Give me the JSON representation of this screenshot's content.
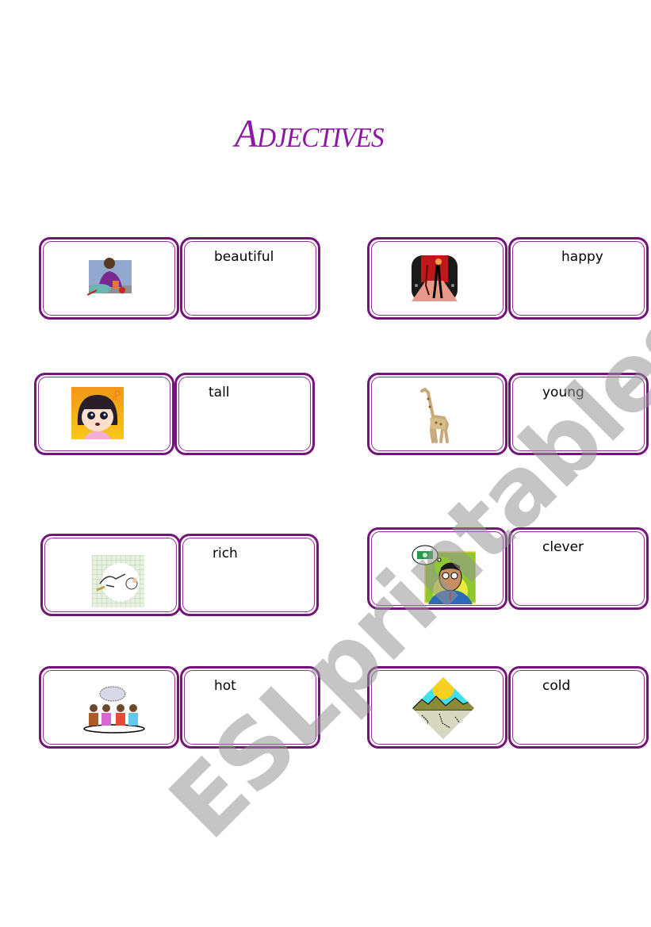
{
  "document": {
    "title": "Adjectives",
    "watermark": "ESLprintables.com"
  },
  "dominoes": [
    {
      "word": "beautiful",
      "picture": "man-eating-meal-icon"
    },
    {
      "word": "happy",
      "picture": "woman-on-runway-icon"
    },
    {
      "word": "tall",
      "picture": "cartoon-girl-icon"
    },
    {
      "word": "young",
      "picture": "giraffe-icon"
    },
    {
      "word": "rich",
      "picture": "stork-carrying-baby-icon"
    },
    {
      "word": "clever",
      "picture": "man-thinking-of-money-icon"
    },
    {
      "word": "hot",
      "picture": "group-brainstorming-icon"
    },
    {
      "word": "cold",
      "picture": "desert-sun-icon"
    }
  ],
  "colors": {
    "title": "#8a1a9e",
    "border": "#74137a",
    "watermark": "#969696"
  }
}
